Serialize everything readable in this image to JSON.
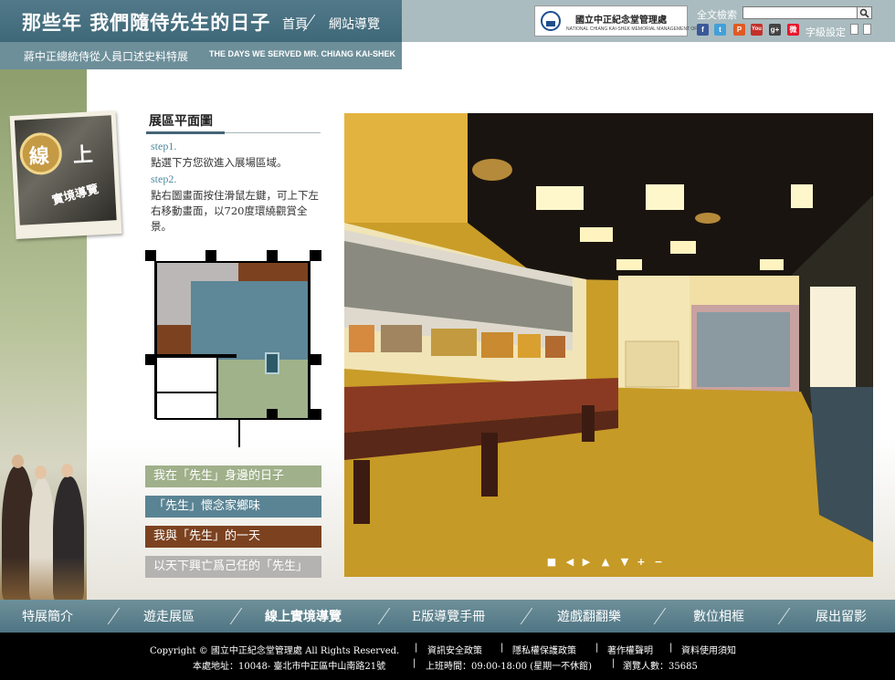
{
  "header": {
    "site_title": "那些年 我們隨侍先生的日子",
    "subtitle_zh": "蔣中正總統侍從人員口述史料特展",
    "subtitle_en": "THE DAYS WE SERVED MR. CHIANG KAI-SHEK",
    "nav": [
      "首頁",
      "網站導覽"
    ],
    "org_name": "國立中正紀念堂管理處",
    "org_name_en": "NATIONAL CHIANG KAI-SHEK MEMORIAL MANAGEMENT OFFICE",
    "search_label": "全文檢索",
    "search_value": "",
    "font_size_label": "字級設定",
    "social_icons": [
      "facebook-icon",
      "twitter-icon",
      "plurk-icon",
      "youtube-icon",
      "google-plus-icon",
      "weibo-icon"
    ]
  },
  "badge": {
    "char1": "線",
    "char2": "上",
    "line2": "實境導覽"
  },
  "floor_plan": {
    "heading": "展區平面圖",
    "step1_label": "step1.",
    "step1_text": "點選下方您欲進入展場區域。",
    "step2_label": "step2.",
    "step2_text": "點右圖畫面按住滑鼠左鍵，可上下左右移動畫面，以720度環繞觀賞全景。",
    "room_colors": {
      "gray": "#bbb7b7",
      "brown": "#7c4220",
      "blue": "#5e8797",
      "green": "#9fb28a"
    }
  },
  "zones": [
    {
      "label": "我在「先生」身邊的日子",
      "color": "#9fb08a"
    },
    {
      "label": "「先生」懷念家鄉味",
      "color": "#5a8494"
    },
    {
      "label": "我與「先生」的一天",
      "color": "#7c4220"
    },
    {
      "label": "以天下興亡爲己任的「先生」",
      "color": "#b5b2b2"
    }
  ],
  "panorama_controls": [
    "stop-icon",
    "arrow-left-icon",
    "arrow-right-icon",
    "arrow-up-icon",
    "arrow-down-icon",
    "zoom-in-icon",
    "zoom-out-icon"
  ],
  "bottom_nav": [
    "特展簡介",
    "遊走展區",
    "線上實境導覽",
    "E版導覽手冊",
    "遊戲翻翻樂",
    "數位相框",
    "展出留影"
  ],
  "footer": {
    "copyright": "Copyright © 國立中正紀念堂管理處 All Rights Reserved.",
    "links": [
      "資訊安全政策",
      "隱私權保護政策",
      "著作權聲明",
      "資料使用須知"
    ],
    "address": "本處地址：10048- 臺北市中正區中山南路21號",
    "hours": "上班時間：09:00-18:00 (星期一不休館)",
    "visitors": "瀏覽人數：35685"
  }
}
